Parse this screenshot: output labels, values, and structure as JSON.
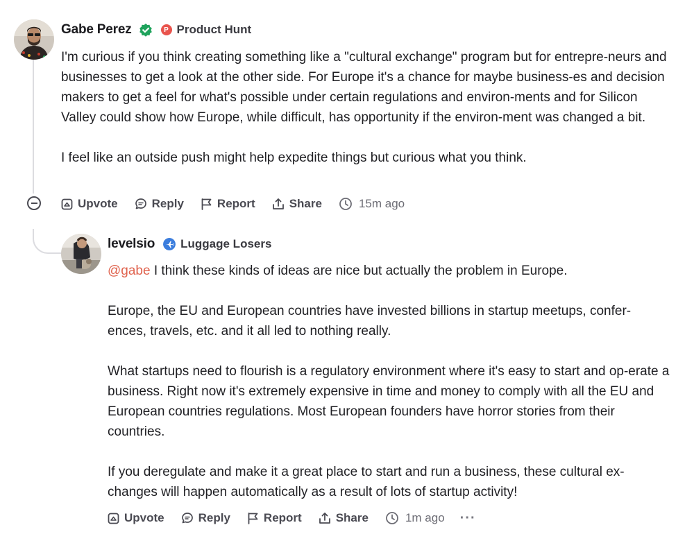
{
  "comments": [
    {
      "author": "Gabe Perez",
      "org": "Product Hunt",
      "org_logo_letter": "P",
      "org_color": "#e9544d",
      "paragraphs": [
        "I'm curious if you think creating something like a \"cultural exchange\" program but for entrepre-neurs and businesses to get a look at the other side. For Europe it's a chance for maybe business-es and decision makers to get a feel for what's possible under certain regulations and environ-ments and for Silicon Valley could show how Europe, while difficult, has opportunity if the environ-ment was changed a bit.",
        "I feel like an outside push might help expedite things but curious what you think."
      ],
      "actions": {
        "upvote": "Upvote",
        "reply": "Reply",
        "report": "Report",
        "share": "Share"
      },
      "time": "15m ago"
    },
    {
      "author": "levelsio",
      "org": "Luggage Losers",
      "org_color": "#3b7ddd",
      "mention": "@gabe",
      "first_line_rest": " I think these kinds of ideas are nice but actually the problem in Europe.",
      "paragraphs": [
        "Europe, the EU and European countries have invested billions in startup meetups, confer-ences, travels, etc. and it all led to nothing really.",
        "What startups need to flourish is a regulatory environment where it's easy to start and op-erate a business. Right now it's extremely expensive in time and money to comply with all the EU and European countries regulations. Most European founders have horror stories from their countries.",
        "If you deregulate and make it a great place to start and run a business, these cultural ex-changes will happen automatically as a result of lots of startup activity!"
      ],
      "actions": {
        "upvote": "Upvote",
        "reply": "Reply",
        "report": "Report",
        "share": "Share"
      },
      "time": "1m ago",
      "more": "···"
    }
  ],
  "colors": {
    "accent_mention": "#e0634e",
    "verified": "#1fa35c",
    "thread_line": "#dcdce0"
  }
}
